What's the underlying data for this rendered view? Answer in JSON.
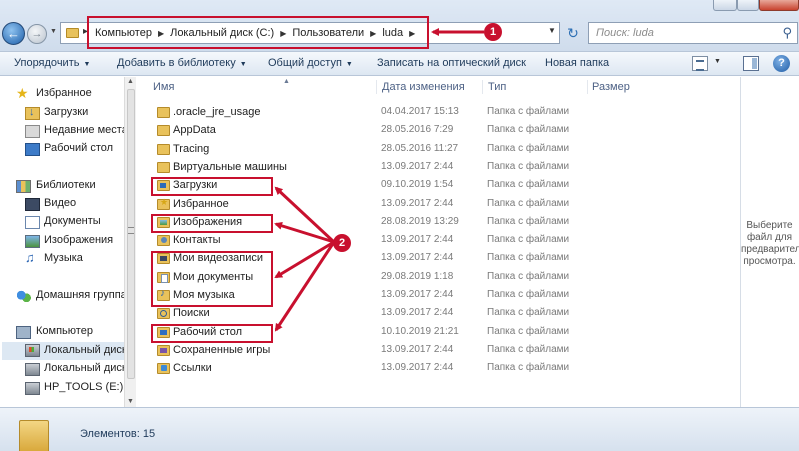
{
  "address": {
    "crumbs": [
      "Компьютер",
      "Локальный диск (C:)",
      "Пользователи",
      "luda"
    ],
    "search_placeholder": "Поиск: luda"
  },
  "toolbar": {
    "organize": "Упорядочить",
    "add_library": "Добавить в библиотеку",
    "share": "Общий доступ",
    "burn": "Записать на оптический диск",
    "new_folder": "Новая папка",
    "help_glyph": "?"
  },
  "nav": {
    "favorites": "Избранное",
    "downloads": "Загрузки",
    "recent": "Недавние места",
    "desktop": "Рабочий стол",
    "libraries": "Библиотеки",
    "video": "Видео",
    "documents": "Документы",
    "images": "Изображения",
    "music": "Музыка",
    "homegroup": "Домашняя группа",
    "computer": "Компьютер",
    "local_disk": "Локальный диск",
    "local_disk2": "Локальный диск",
    "hp_tools": "HP_TOOLS (E:)"
  },
  "columns": {
    "name": "Имя",
    "date": "Дата изменения",
    "type": "Тип",
    "size": "Размер"
  },
  "rows": [
    {
      "name": ".oracle_jre_usage",
      "date": "04.04.2017 15:13",
      "type": "Папка с файлами"
    },
    {
      "name": "AppData",
      "date": "28.05.2016 7:29",
      "type": "Папка с файлами"
    },
    {
      "name": "Tracing",
      "date": "28.05.2016 11:27",
      "type": "Папка с файлами"
    },
    {
      "name": "Виртуальные машины",
      "date": "13.09.2017 2:44",
      "type": "Папка с файлами"
    },
    {
      "name": "Загрузки",
      "date": "09.10.2019 1:54",
      "type": "Папка с файлами"
    },
    {
      "name": "Избранное",
      "date": "13.09.2017 2:44",
      "type": "Папка с файлами"
    },
    {
      "name": "Изображения",
      "date": "28.08.2019 13:29",
      "type": "Папка с файлами"
    },
    {
      "name": "Контакты",
      "date": "13.09.2017 2:44",
      "type": "Папка с файлами"
    },
    {
      "name": "Мои видеозаписи",
      "date": "13.09.2017 2:44",
      "type": "Папка с файлами"
    },
    {
      "name": "Мои документы",
      "date": "29.08.2019 1:18",
      "type": "Папка с файлами"
    },
    {
      "name": "Моя музыка",
      "date": "13.09.2017 2:44",
      "type": "Папка с файлами"
    },
    {
      "name": "Поиски",
      "date": "13.09.2017 2:44",
      "type": "Папка с файлами"
    },
    {
      "name": "Рабочий стол",
      "date": "10.10.2019 21:21",
      "type": "Папка с файлами"
    },
    {
      "name": "Сохраненные игры",
      "date": "13.09.2017 2:44",
      "type": "Папка с файлами"
    },
    {
      "name": "Ссылки",
      "date": "13.09.2017 2:44",
      "type": "Папка с файлами"
    }
  ],
  "preview_text": "Выберите файл для предварительного просмотра.",
  "status": "Элементов: 15",
  "annotations": {
    "badge1": "1",
    "badge2": "2"
  },
  "colors": {
    "annotation_red": "#c8102e",
    "folder_yellow": "#e9c25b",
    "header_blue": "#4d6185"
  }
}
